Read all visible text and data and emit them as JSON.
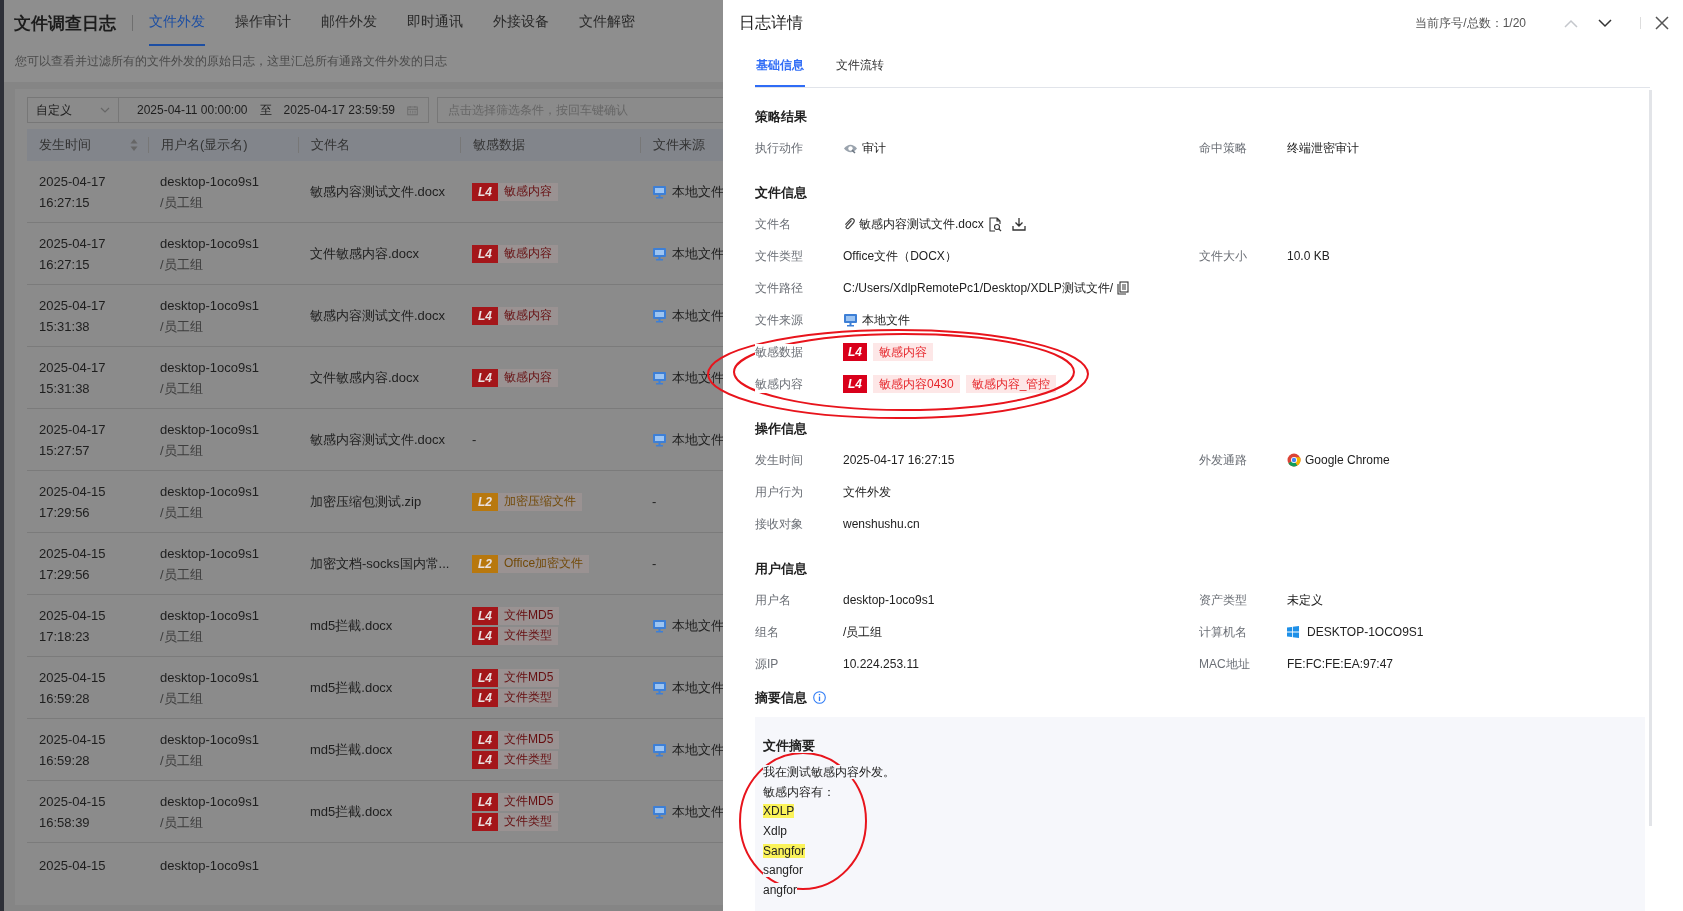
{
  "app": {
    "title": "文件调查日志",
    "tabs": [
      {
        "label": "文件外发",
        "selected": true
      },
      {
        "label": "操作审计",
        "selected": false
      },
      {
        "label": "邮件外发",
        "selected": false
      },
      {
        "label": "即时通讯",
        "selected": false
      },
      {
        "label": "外接设备",
        "selected": false
      },
      {
        "label": "文件解密",
        "selected": false
      }
    ],
    "description": "您可以查看并过滤所有的文件外发的原始日志，这里汇总所有通路文件外发的日志"
  },
  "filter": {
    "preset": "自定义",
    "start": "2025-04-11 00:00:00",
    "separator": "至",
    "end": "2025-04-17 23:59:59",
    "placeholder": "点击选择筛选条件，按回车键确认"
  },
  "table": {
    "columns": [
      {
        "label": "发生时间",
        "sortable": true
      },
      {
        "label": "用户名(显示名)",
        "sortable": false
      },
      {
        "label": "文件名",
        "sortable": false
      },
      {
        "label": "敏感数据",
        "sortable": false
      },
      {
        "label": "文件来源",
        "sortable": false
      }
    ],
    "rows": [
      {
        "date": "2025-04-17",
        "time": "16:27:15",
        "user": "desktop-1oco9s1",
        "group": "/员工组",
        "file": "敏感内容测试文件.docx",
        "tags": [
          {
            "badge": "L4",
            "label": "敏感内容",
            "color": "#a4161a"
          }
        ],
        "source": {
          "kind": "local",
          "text": "本地文件"
        }
      },
      {
        "date": "2025-04-17",
        "time": "16:27:15",
        "user": "desktop-1oco9s1",
        "group": "/员工组",
        "file": "文件敏感内容.docx",
        "tags": [
          {
            "badge": "L4",
            "label": "敏感内容",
            "color": "#a4161a"
          }
        ],
        "source": {
          "kind": "local",
          "text": "本地文件"
        }
      },
      {
        "date": "2025-04-17",
        "time": "15:31:38",
        "user": "desktop-1oco9s1",
        "group": "/员工组",
        "file": "敏感内容测试文件.docx",
        "tags": [
          {
            "badge": "L4",
            "label": "敏感内容",
            "color": "#a4161a"
          }
        ],
        "source": {
          "kind": "local",
          "text": "本地文件"
        }
      },
      {
        "date": "2025-04-17",
        "time": "15:31:38",
        "user": "desktop-1oco9s1",
        "group": "/员工组",
        "file": "文件敏感内容.docx",
        "tags": [
          {
            "badge": "L4",
            "label": "敏感内容",
            "color": "#a4161a"
          }
        ],
        "source": {
          "kind": "local",
          "text": "本地文件"
        }
      },
      {
        "date": "2025-04-17",
        "time": "15:27:57",
        "user": "desktop-1oco9s1",
        "group": "/员工组",
        "file": "敏感内容测试文件.docx",
        "empty_tags": "-",
        "source": {
          "kind": "local",
          "text": "本地文件"
        }
      },
      {
        "date": "2025-04-15",
        "time": "17:29:56",
        "user": "desktop-1oco9s1",
        "group": "/员工组",
        "file": "加密压缩包测试.zip",
        "tags": [
          {
            "badge": "L2",
            "label": "加密压缩文件",
            "color": "#b8780e"
          }
        ],
        "source": {
          "kind": "none",
          "text": "-"
        }
      },
      {
        "date": "2025-04-15",
        "time": "17:29:56",
        "user": "desktop-1oco9s1",
        "group": "/员工组",
        "file": "加密文档-socks国内常...",
        "tags": [
          {
            "badge": "L2",
            "label": "Office加密文件",
            "color": "#b8780e"
          }
        ],
        "source": {
          "kind": "none",
          "text": "-"
        }
      },
      {
        "date": "2025-04-15",
        "time": "17:18:23",
        "user": "desktop-1oco9s1",
        "group": "/员工组",
        "file": "md5拦截.docx",
        "tags": [
          {
            "badge": "L4",
            "label": "文件MD5",
            "color": "#a4161a"
          },
          {
            "badge": "L4",
            "label": "文件类型",
            "color": "#a4161a"
          }
        ],
        "source": {
          "kind": "local",
          "text": "本地文件"
        }
      },
      {
        "date": "2025-04-15",
        "time": "16:59:28",
        "user": "desktop-1oco9s1",
        "group": "/员工组",
        "file": "md5拦截.docx",
        "tags": [
          {
            "badge": "L4",
            "label": "文件MD5",
            "color": "#a4161a"
          },
          {
            "badge": "L4",
            "label": "文件类型",
            "color": "#a4161a"
          }
        ],
        "source": {
          "kind": "local",
          "text": "本地文件"
        }
      },
      {
        "date": "2025-04-15",
        "time": "16:59:28",
        "user": "desktop-1oco9s1",
        "group": "/员工组",
        "file": "md5拦截.docx",
        "tags": [
          {
            "badge": "L4",
            "label": "文件MD5",
            "color": "#a4161a"
          },
          {
            "badge": "L4",
            "label": "文件类型",
            "color": "#a4161a"
          }
        ],
        "source": {
          "kind": "local",
          "text": "本地文件"
        }
      },
      {
        "date": "2025-04-15",
        "time": "16:58:39",
        "user": "desktop-1oco9s1",
        "group": "/员工组",
        "file": "md5拦截.docx",
        "tags": [
          {
            "badge": "L4",
            "label": "文件MD5",
            "color": "#a4161a"
          },
          {
            "badge": "L4",
            "label": "文件类型",
            "color": "#a4161a"
          }
        ],
        "source": {
          "kind": "local",
          "text": "本地文件"
        }
      },
      {
        "date": "2025-04-15",
        "user": "desktop-1oco9s1"
      }
    ]
  },
  "detail": {
    "title": "日志详情",
    "counter": "当前序号/总数：1/20",
    "prev": {
      "disabled": true
    },
    "next": {
      "disabled": false
    },
    "tabs": [
      {
        "label": "基础信息",
        "selected": true
      },
      {
        "label": "文件流转",
        "selected": false
      }
    ],
    "sections": [
      {
        "title": "策略结果",
        "rows": [
          [
            {
              "label": "执行动作",
              "kind": "action",
              "value": "审计"
            },
            {
              "label": "命中策略",
              "kind": "text",
              "value": "终端泄密审计"
            }
          ]
        ]
      },
      {
        "title": "文件信息",
        "rows": [
          [
            {
              "label": "文件名",
              "kind": "file",
              "value": "敏感内容测试文件.docx"
            }
          ],
          [
            {
              "label": "文件类型",
              "kind": "text",
              "value": "Office文件（DOCX）"
            },
            {
              "label": "文件大小",
              "kind": "text",
              "value": "10.0 KB"
            }
          ],
          [
            {
              "label": "文件路径",
              "kind": "path",
              "value": "C:/Users/XdlpRemotePc1/Desktop/XDLP测试文件/"
            }
          ],
          [
            {
              "label": "文件来源",
              "kind": "source",
              "value": "本地文件"
            }
          ],
          [
            {
              "label": "敏感数据",
              "kind": "tags",
              "tags": [
                {
                  "badge": "L4",
                  "color": "#d9001b",
                  "labels": [
                    "敏感内容"
                  ]
                }
              ]
            }
          ],
          [
            {
              "label": "敏感内容",
              "kind": "tags",
              "tags": [
                {
                  "badge": "L4",
                  "color": "#d9001b",
                  "labels": [
                    "敏感内容0430",
                    "敏感内容_管控"
                  ]
                }
              ]
            }
          ]
        ]
      },
      {
        "title": "操作信息",
        "rows": [
          [
            {
              "label": "发生时间",
              "kind": "text",
              "value": "2025-04-17 16:27:15"
            },
            {
              "label": "外发通路",
              "kind": "browser",
              "value": "Google Chrome"
            }
          ],
          [
            {
              "label": "用户行为",
              "kind": "text",
              "value": "文件外发"
            }
          ],
          [
            {
              "label": "接收对象",
              "kind": "text",
              "value": "wenshushu.cn"
            }
          ]
        ]
      },
      {
        "title": "用户信息",
        "rows": [
          [
            {
              "label": "用户名",
              "kind": "text",
              "value": "desktop-1oco9s1"
            },
            {
              "label": "资产类型",
              "kind": "text",
              "value": "未定义"
            }
          ],
          [
            {
              "label": "组名",
              "kind": "text",
              "value": "/员工组"
            },
            {
              "label": "计算机名",
              "kind": "windows",
              "value": "DESKTOP-1OCO9S1"
            }
          ],
          [
            {
              "label": "源IP",
              "kind": "text",
              "value": "10.224.253.11"
            },
            {
              "label": "MAC地址",
              "kind": "text",
              "value": "FE:FC:FE:EA:97:47"
            }
          ]
        ]
      }
    ],
    "summary": {
      "title": "摘要信息",
      "box_title": "文件摘要",
      "lines": [
        {
          "text": "我在测试敏感内容外发。",
          "highlighted": false
        },
        {
          "text": "敏感内容有：",
          "highlighted": false
        },
        {
          "text": "XDLP",
          "highlighted": true
        },
        {
          "text": "Xdlp",
          "highlighted": false
        },
        {
          "text": "Sangfor",
          "highlighted": true
        },
        {
          "text": "sangfor",
          "highlighted": false
        },
        {
          "text": "angfor",
          "highlighted": false
        }
      ]
    }
  }
}
